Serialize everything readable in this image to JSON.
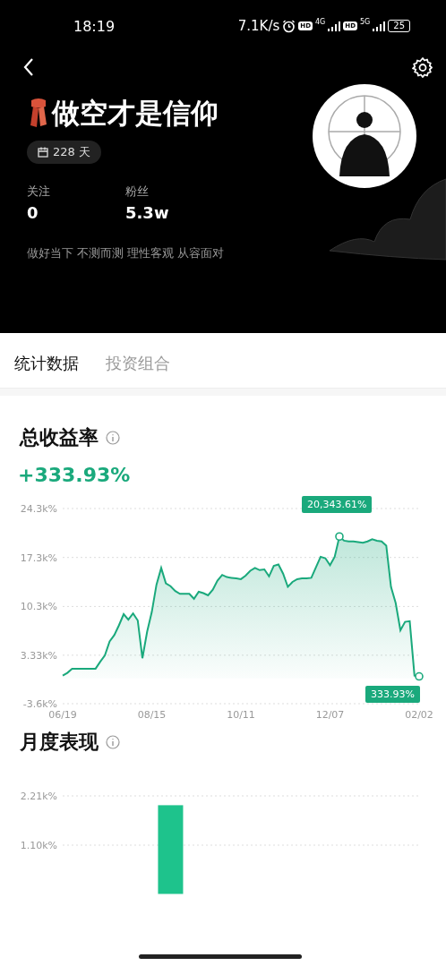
{
  "status_bar": {
    "time": "18:19",
    "speed": "7.1K/s",
    "hd_1": "HD",
    "network_1": "4G",
    "hd_2": "HD",
    "network_2": "5G",
    "battery": "25"
  },
  "profile": {
    "name": "做空才是信仰",
    "days_badge": "228 天",
    "stats": [
      {
        "label": "关注",
        "value": "0"
      },
      {
        "label": "粉丝",
        "value": "5.3w"
      }
    ],
    "bio": "做好当下 不测而测 理性客观 从容面对"
  },
  "tabs": [
    {
      "label": "统计数据",
      "selected": true
    },
    {
      "label": "投资组合",
      "selected": false
    }
  ],
  "total_return": {
    "title": "总收益率",
    "value": "+333.93%",
    "chart_data": {
      "type": "area",
      "categories": [
        "06/19",
        null,
        null,
        null,
        null,
        null,
        null,
        null,
        null,
        null,
        null,
        null,
        null,
        null,
        null,
        null,
        null,
        null,
        null,
        "08/15",
        null,
        null,
        null,
        null,
        null,
        null,
        null,
        null,
        null,
        null,
        null,
        null,
        null,
        null,
        null,
        null,
        null,
        null,
        "10/11",
        null,
        null,
        null,
        null,
        null,
        null,
        null,
        null,
        null,
        null,
        null,
        null,
        null,
        null,
        null,
        null,
        null,
        null,
        "12/07",
        null,
        null,
        null,
        null,
        null,
        null,
        null,
        null,
        null,
        null,
        null,
        null,
        null,
        null,
        null,
        null,
        null,
        null,
        "02/02"
      ],
      "series": [
        {
          "color": "#1aa97c",
          "values": [
            0.4,
            0.8,
            1.4,
            1.4,
            1.4,
            1.4,
            1.4,
            1.4,
            2.4,
            3.3,
            5.3,
            6.2,
            7.6,
            9.2,
            8.4,
            9.3,
            8.3,
            2.9,
            6.7,
            9.5,
            13.4,
            15.8,
            13.6,
            13.2,
            12.5,
            12.1,
            12.1,
            12.1,
            11.4,
            12.4,
            12.2,
            11.9,
            12.7,
            14.0,
            14.8,
            14.5,
            14.4,
            14.3,
            14.2,
            14.7,
            15.4,
            15.8,
            15.5,
            15.6,
            14.6,
            16.1,
            16.3,
            15.0,
            13.1,
            13.8,
            14.2,
            14.3,
            14.3,
            14.4,
            15.9,
            17.4,
            17.2,
            16.2,
            17.4,
            20.3,
            19.7,
            19.6,
            19.6,
            19.5,
            19.4,
            19.6,
            19.9,
            19.7,
            19.6,
            19.0,
            13.1,
            10.8,
            6.9,
            8.1,
            8.2,
            0.4,
            0.3
          ]
        }
      ],
      "yticks": [
        {
          "value": 24.3,
          "label": "24.3k%"
        },
        {
          "value": 17.3,
          "label": "17.3k%"
        },
        {
          "value": 10.3,
          "label": "10.3k%"
        },
        {
          "value": 3.33,
          "label": "3.33k%"
        },
        {
          "value": -3.6,
          "label": "-3.6k%"
        }
      ],
      "ylim": [
        -3.6,
        24.3
      ],
      "grid": true,
      "annotations": [
        {
          "y": 20.3,
          "text": "20,343.61%"
        },
        {
          "x": "02/02",
          "y": 0.3,
          "text": "333.93%"
        }
      ]
    }
  },
  "monthly": {
    "title": "月度表现",
    "chart_data": {
      "type": "bar",
      "values": [
        null,
        null,
        2.0,
        null,
        null,
        null,
        null,
        null,
        null
      ],
      "yticks": [
        {
          "value": 2.21,
          "label": "2.21k%"
        },
        {
          "value": 1.1,
          "label": "1.10k%"
        }
      ],
      "ylim": [
        0,
        2.21
      ]
    }
  }
}
